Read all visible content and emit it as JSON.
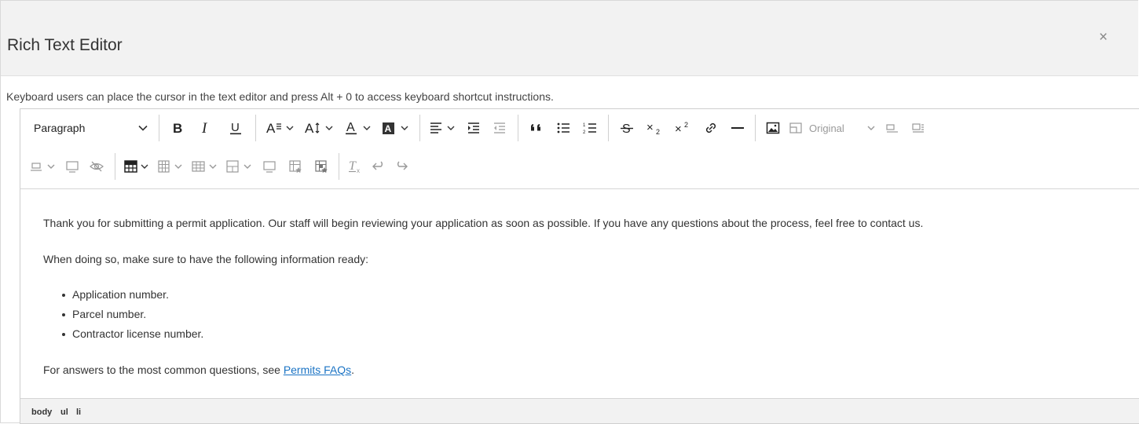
{
  "dialog": {
    "title": "Rich Text Editor",
    "close_glyph": "×"
  },
  "hint": "Keyboard users can place the cursor in the text editor and press Alt + 0 to access keyboard shortcut instructions.",
  "toolbar": {
    "format_select": "Paragraph",
    "image_size_select": "Original",
    "icons": [
      "bold-icon",
      "italic-icon",
      "underline-icon",
      "font-family-icon",
      "font-size-icon",
      "font-color-icon",
      "background-color-icon",
      "align-icon",
      "indent-icon",
      "outdent-icon",
      "blockquote-icon",
      "bulleted-list-icon",
      "numbered-list-icon",
      "strikethrough-icon",
      "subscript-icon",
      "superscript-icon",
      "link-icon",
      "horizontal-rule-icon",
      "image-icon",
      "image-frame-icon",
      "image-align-left-icon",
      "image-align-right-icon",
      "image-align-center-icon",
      "image-caption-icon",
      "hide-icon",
      "table-icon",
      "table-column-icon",
      "table-row-icon",
      "table-cells-icon",
      "table-caption-icon",
      "table-props-icon",
      "cell-props-icon",
      "clear-format-icon",
      "undo-icon",
      "redo-icon"
    ]
  },
  "content": {
    "p1": "Thank you for submitting a permit application. Our staff will begin reviewing your application as soon as possible. If you have any questions about the process, feel free to contact us.",
    "p2": "When doing so, make sure to have the following information ready:",
    "list": [
      "Application number.",
      "Parcel number.",
      "Contractor license number."
    ],
    "p3_before": "For answers to the most common questions, see ",
    "p3_link": "Permits FAQs",
    "p3_after": "."
  },
  "statusbar": {
    "path": [
      "body",
      "ul",
      "li"
    ]
  }
}
